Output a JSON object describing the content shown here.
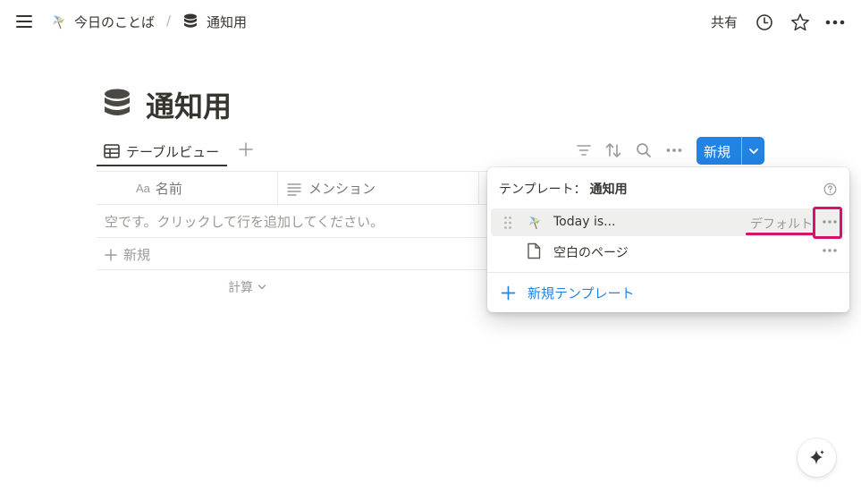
{
  "topbar": {
    "breadcrumb": [
      {
        "label": "今日のことば",
        "icon": "pinwheel-icon"
      },
      {
        "separator": "/"
      },
      {
        "label": "通知用",
        "icon": "database-icon"
      }
    ],
    "share_label": "共有",
    "icons": [
      "menu-icon",
      "clock-icon",
      "star-icon",
      "more-horizontal-icon"
    ]
  },
  "page": {
    "title": "通知用",
    "title_icon": "database-icon"
  },
  "view_bar": {
    "view_label": "テーブルビュー",
    "new_button_label": "新規",
    "accent_color": "#2383e2",
    "icons": [
      "table-icon",
      "plus-icon",
      "filter-icon",
      "sort-icon",
      "search-icon",
      "more-horizontal-icon",
      "chevron-down-icon"
    ]
  },
  "table": {
    "columns": [
      {
        "icon_text": "Aa",
        "label": "名前"
      },
      {
        "icon": "text-lines-icon",
        "label": "メンション"
      }
    ],
    "empty_message": "空です。クリックして行を追加してください。",
    "add_row_label": "新規",
    "calc_label": "計算"
  },
  "template_popup": {
    "title_prefix": "テンプレート：",
    "title_database": "通知用",
    "templates": [
      {
        "label": "Today is...",
        "icon": "pinwheel-icon",
        "badge": "デフォルト",
        "highlighted": true
      },
      {
        "label": "空白のページ",
        "icon": "page-icon"
      }
    ],
    "new_template_label": "新規テンプレート",
    "highlight_color": "#d4136b"
  }
}
